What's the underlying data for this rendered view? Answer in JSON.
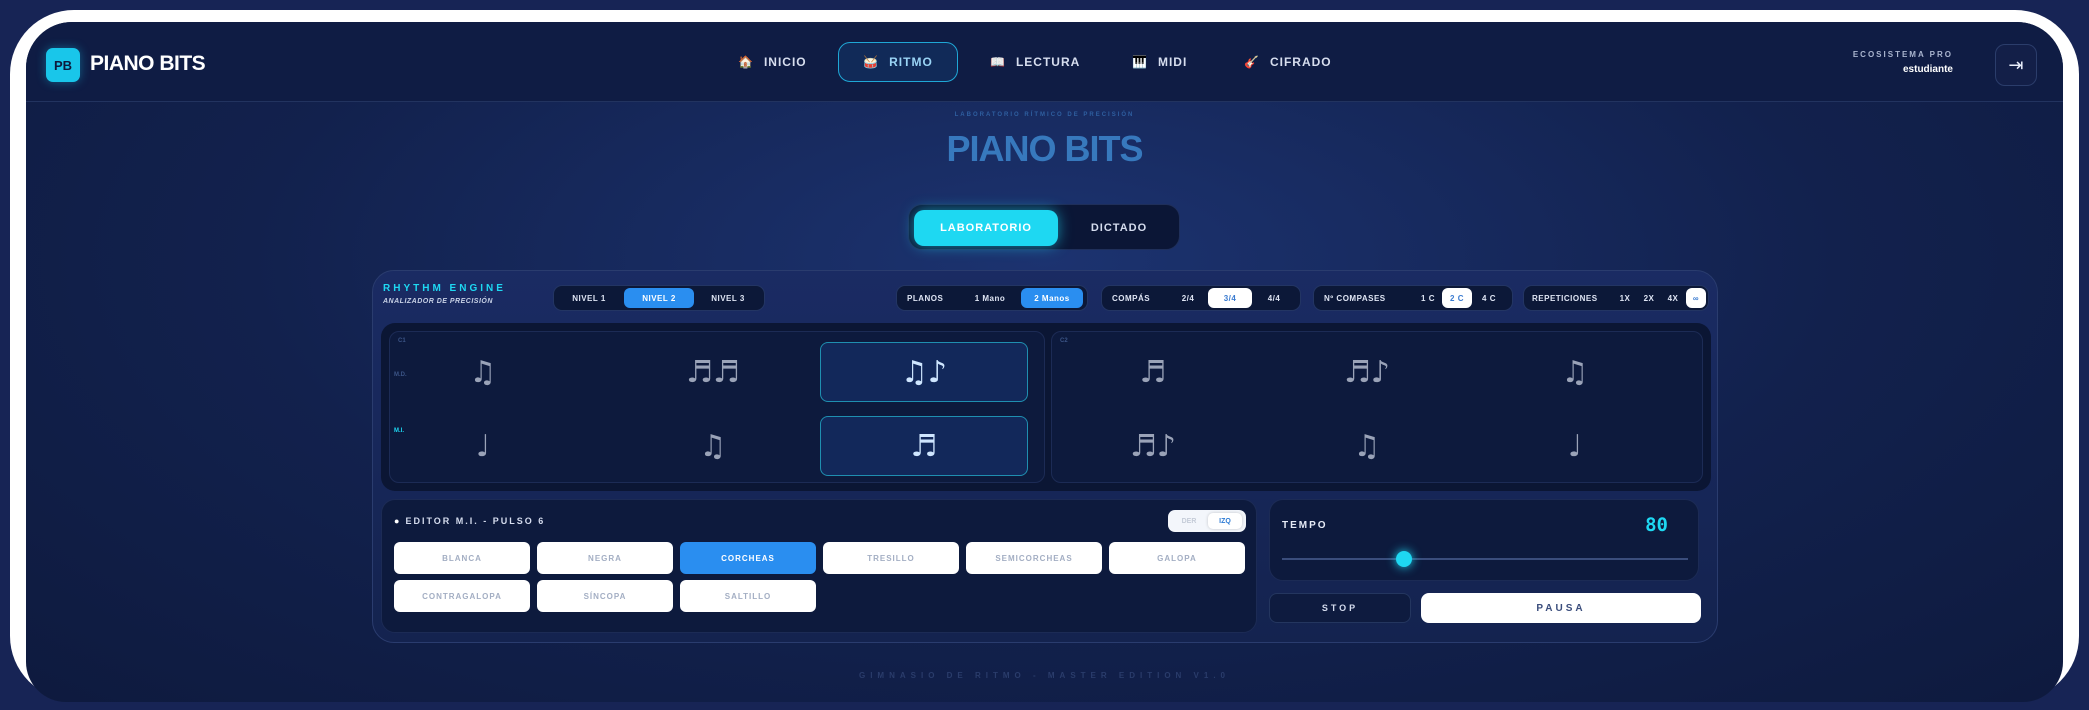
{
  "app": {
    "logo_badge": "PB",
    "logo_text": "PIANO BITS"
  },
  "nav": [
    {
      "label": "INICIO",
      "icon": "house-icon",
      "glyph": "🏠"
    },
    {
      "label": "RITMO",
      "icon": "drum-icon",
      "glyph": "🥁"
    },
    {
      "label": "LECTURA",
      "icon": "book-icon",
      "glyph": "📖"
    },
    {
      "label": "MIDI",
      "icon": "piano-icon",
      "glyph": "🎹"
    },
    {
      "label": "CIFRADO",
      "icon": "guitar-icon",
      "glyph": "🎸"
    }
  ],
  "nav_active": "RITMO",
  "account": {
    "label": "ECOSISTEMA PRO",
    "user": "estudiante",
    "logout_glyph": "⇥"
  },
  "hero": {
    "subtitle": "LABORATORIO RÍTMICO DE PRECISIÓN",
    "title": "PIANO BITS"
  },
  "mode": {
    "options": [
      "LABORATORIO",
      "DICTADO"
    ],
    "selected": "LABORATORIO"
  },
  "engine": {
    "title": "RHYTHM ENGINE",
    "subtitle": "ANALIZADOR DE PRECISIÓN",
    "levels": [
      "NIVEL 1",
      "NIVEL 2",
      "NIVEL 3"
    ],
    "level_selected": "NIVEL 2",
    "planos": {
      "label": "PLANOS",
      "options": [
        "1 Mano",
        "2 Manos"
      ],
      "selected": "2 Manos"
    },
    "compas": {
      "label": "COMPÁS",
      "options": [
        "2/4",
        "3/4",
        "4/4"
      ],
      "selected": "3/4"
    },
    "compases": {
      "label": "Nº COMPASES",
      "options": [
        "1 C",
        "2 C",
        "4 C"
      ],
      "selected": "2 C"
    },
    "repeticiones": {
      "label": "REPETICIONES",
      "options": [
        "1X",
        "2X",
        "4X",
        "∞"
      ],
      "selected": "∞"
    }
  },
  "measures": [
    {
      "number": "C1",
      "row_labels": [
        "M.D.",
        "M.I."
      ],
      "upper": [
        {
          "glyph": "♫"
        },
        {
          "glyph": "♬♬"
        },
        {
          "glyph": "♫♪",
          "active": true
        }
      ],
      "lower": [
        {
          "glyph": "♩"
        },
        {
          "glyph": "♫"
        },
        {
          "glyph": "♬",
          "active": true
        }
      ]
    },
    {
      "number": "C2",
      "upper": [
        {
          "glyph": "♬"
        },
        {
          "glyph": "♬♪"
        },
        {
          "glyph": "♫"
        }
      ],
      "lower": [
        {
          "glyph": "♬♪"
        },
        {
          "glyph": "♫"
        },
        {
          "glyph": "♩"
        }
      ]
    }
  ],
  "editor": {
    "title": "EDITOR M.I. - PULSO 6",
    "hands": [
      "DER",
      "IZQ"
    ],
    "hand_selected": "IZQ",
    "figures": [
      "BLANCA",
      "NEGRA",
      "CORCHEAS",
      "TRESILLO",
      "SEMICORCHEAS",
      "GALOPA",
      "CONTRAGALOPA",
      "SÍNCOPA",
      "SALTILLO"
    ],
    "figure_selected": "CORCHEAS"
  },
  "tempo": {
    "label": "TEMPO",
    "value": "80",
    "slider_fraction": 0.3
  },
  "transport": {
    "stop": "STOP",
    "pause": "PAUSA"
  },
  "footer": "GIMNASIO DE RITMO - MASTER EDITION V1.0",
  "colors": {
    "accent": "#1ed8f2",
    "selected": "#2a8ef0",
    "background": "#12214d"
  }
}
